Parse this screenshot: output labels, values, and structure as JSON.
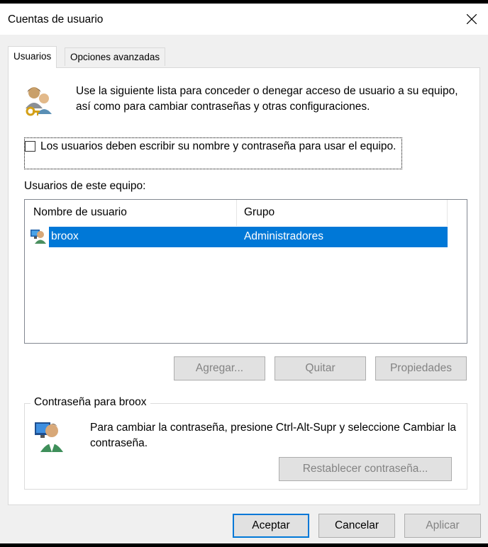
{
  "window": {
    "title": "Cuentas de usuario"
  },
  "tabs": [
    {
      "label": "Usuarios",
      "active": true
    },
    {
      "label": "Opciones avanzadas",
      "active": false
    }
  ],
  "intro_text": "Use la siguiente lista para conceder o denegar acceso de usuario a su equipo, así como para cambiar contraseñas y otras configuraciones.",
  "require_login": {
    "label": "Los usuarios deben escribir su nombre y contraseña para usar el equipo.",
    "checked": false
  },
  "users_list": {
    "label": "Usuarios de este equipo:",
    "columns": [
      "Nombre de usuario",
      "Grupo"
    ],
    "rows": [
      {
        "name": "broox",
        "group": "Administradores",
        "selected": true
      }
    ]
  },
  "list_buttons": {
    "add": "Agregar...",
    "remove": "Quitar",
    "properties": "Propiedades"
  },
  "password_group": {
    "title": "Contraseña para broox",
    "text": "Para cambiar la contraseña, presione Ctrl-Alt-Supr y seleccione Cambiar la contraseña.",
    "reset_button": "Restablecer contraseña..."
  },
  "dialog_buttons": {
    "ok": "Aceptar",
    "cancel": "Cancelar",
    "apply": "Aplicar"
  },
  "colors": {
    "selection": "#0078d7",
    "window_bg": "#f0f0f0",
    "disabled_text": "#838383"
  },
  "icons": {
    "users": "users-keys-icon",
    "user_row": "user-monitor-icon",
    "password": "user-monitor-icon",
    "close": "close-icon"
  }
}
